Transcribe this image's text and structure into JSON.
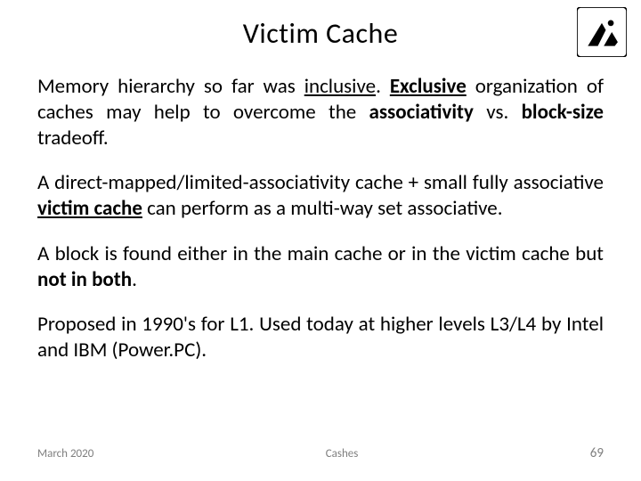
{
  "title": "Victim Cache",
  "p1": {
    "t1": "Memory hierarchy so far was ",
    "inc": "inclusive",
    "t2": ". ",
    "exc": "Exclusive",
    "t3": " organization of caches may help to overcome the ",
    "assoc": "associativity",
    "t4": " vs. ",
    "bs": "block-size",
    "t5": " tradeoff."
  },
  "p2": {
    "t1": "A direct-mapped/limited-associativity cache + small fully associative ",
    "vc": "victim cache",
    "t2": " can perform as a multi-way set associative."
  },
  "p3": {
    "t1": "A block is found either in the main cache or in the victim cache but ",
    "nb": "not in both",
    "t2": "."
  },
  "p4": {
    "t1": "Proposed in 1990's for L1. Used today at higher levels L3/L4 by Intel and IBM (Power.PC)."
  },
  "footer": {
    "date": "March 2020",
    "center": "Cashes",
    "page": "69"
  },
  "icons": {
    "logo": "institution-logo-icon"
  }
}
